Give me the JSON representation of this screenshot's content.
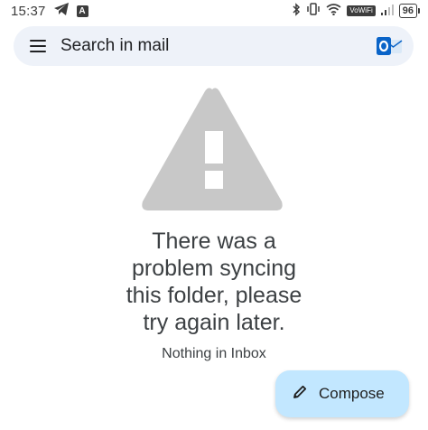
{
  "status_bar": {
    "time": "15:37",
    "notification_badge": "A",
    "network_tag": "VoWiFi",
    "battery": "96"
  },
  "search": {
    "placeholder": "Search in mail",
    "menu_icon": "hamburger-menu-icon",
    "account_icon": "outlook-icon"
  },
  "error": {
    "icon": "warning-triangle-icon",
    "lines": [
      "There was a",
      "problem syncing",
      "this folder, please",
      "try again later."
    ],
    "empty_label": "Nothing in Inbox"
  },
  "compose": {
    "label": "Compose",
    "icon": "pencil-icon"
  },
  "colors": {
    "search_bg": "#eef2f9",
    "compose_bg": "#c2e7ff",
    "warning_gray": "#c8c8c8",
    "outlook_blue": "#0a64c8"
  }
}
